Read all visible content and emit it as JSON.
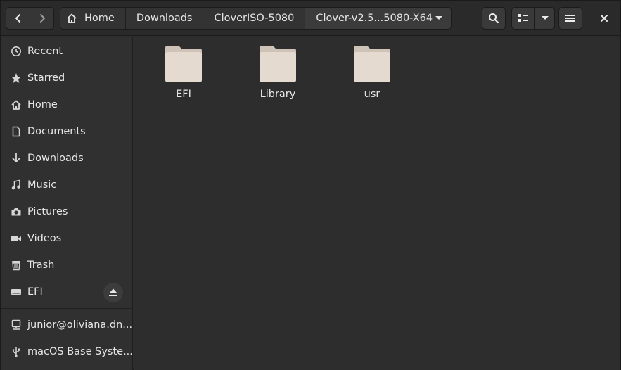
{
  "header": {
    "breadcrumbs": [
      "Home",
      "Downloads",
      "CloverISO-5080",
      "Clover-v2.5...5080-X64"
    ]
  },
  "sidebar": {
    "places": [
      "Recent",
      "Starred",
      "Home",
      "Documents",
      "Downloads",
      "Music",
      "Pictures",
      "Videos",
      "Trash",
      "EFI"
    ],
    "network": [
      "junior@oliviana.dn...",
      "macOS Base Syste..."
    ]
  },
  "files": [
    {
      "name": "EFI",
      "icon": "folder-icon"
    },
    {
      "name": "Library",
      "icon": "folder-icon"
    },
    {
      "name": "usr",
      "icon": "folder-icon"
    }
  ],
  "colors": {
    "background": "#2d2d2d",
    "sidebar": "#303030",
    "folder": "#e5dad0",
    "folder_tab": "#cfc2b6"
  }
}
